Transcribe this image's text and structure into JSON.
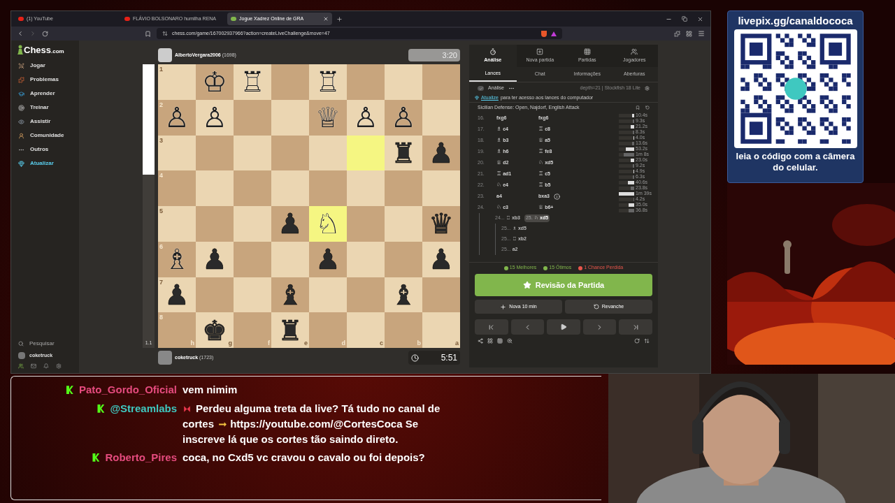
{
  "browser": {
    "tabs": [
      {
        "label": "(1) YouTube",
        "selected": false
      },
      {
        "label": "FLÁVIO BOLSONARO humilha RENA",
        "selected": false
      },
      {
        "label": "Jogue Xadrez Online de GRA",
        "selected": true
      }
    ],
    "url": "chess.com/game/167002937966?action=createLiveChallenge&move=47"
  },
  "sidebar": {
    "logo": "Chess",
    "logo_suffix": ".com",
    "items": [
      {
        "label": "Jogar",
        "kind": "link"
      },
      {
        "label": "Problemas",
        "kind": "link"
      },
      {
        "label": "Aprender",
        "kind": "link"
      },
      {
        "label": "Treinar",
        "kind": "link"
      },
      {
        "label": "Assistir",
        "kind": "link"
      },
      {
        "label": "Comunidade",
        "kind": "link"
      },
      {
        "label": "Outros",
        "kind": "more"
      },
      {
        "label": "Atualizar",
        "kind": "upgrade"
      }
    ],
    "search": "Pesquisar",
    "user": "coketruck"
  },
  "eval_bar": {
    "level": 0.39,
    "reading": "1.1"
  },
  "top_player": {
    "name": "AlbertoVergara2006",
    "rating": "(1698)",
    "clock": "3:20",
    "active": false
  },
  "bottom_player": {
    "name": "coketruck",
    "rating": "(1723)",
    "clock": "5:51",
    "active": true
  },
  "board": {
    "files": [
      "h",
      "g",
      "f",
      "e",
      "d",
      "c",
      "b",
      "a"
    ],
    "ranks": [
      {
        "label": "1",
        "squares": [
          {
            "highlighted": false
          },
          {
            "piece": "♔",
            "kind": "white",
            "highlighted": false
          },
          {
            "piece": "♖",
            "kind": "white",
            "highlighted": false
          },
          {
            "highlighted": false
          },
          {
            "piece": "♖",
            "kind": "white",
            "highlighted": false
          },
          {
            "highlighted": false
          },
          {
            "highlighted": false
          },
          {
            "highlighted": false
          }
        ]
      },
      {
        "label": "2",
        "squares": [
          {
            "piece": "♙",
            "kind": "white",
            "highlighted": false
          },
          {
            "piece": "♙",
            "kind": "white",
            "highlighted": false
          },
          {
            "highlighted": false
          },
          {
            "highlighted": false
          },
          {
            "piece": "♕",
            "kind": "white",
            "highlighted": false
          },
          {
            "piece": "♙",
            "kind": "white",
            "highlighted": false
          },
          {
            "piece": "♙",
            "kind": "white",
            "highlighted": false
          },
          {
            "highlighted": false
          }
        ]
      },
      {
        "label": "3",
        "squares": [
          {
            "highlighted": false
          },
          {
            "highlighted": false
          },
          {
            "highlighted": false
          },
          {
            "highlighted": false
          },
          {
            "highlighted": false
          },
          {
            "highlighted": true
          },
          {
            "piece": "♜",
            "kind": "black",
            "highlighted": false
          },
          {
            "piece": "♟",
            "kind": "black",
            "highlighted": false
          }
        ]
      },
      {
        "label": "4",
        "squares": [
          {
            "highlighted": false
          },
          {
            "highlighted": false
          },
          {
            "highlighted": false
          },
          {
            "highlighted": false
          },
          {
            "highlighted": false
          },
          {
            "highlighted": false
          },
          {
            "highlighted": false
          },
          {
            "highlighted": false
          }
        ]
      },
      {
        "label": "5",
        "squares": [
          {
            "highlighted": false
          },
          {
            "highlighted": false
          },
          {
            "highlighted": false
          },
          {
            "piece": "♟",
            "kind": "black",
            "highlighted": false
          },
          {
            "piece": "♘",
            "kind": "white",
            "highlighted": true
          },
          {
            "highlighted": false
          },
          {
            "highlighted": false
          },
          {
            "piece": "♛",
            "kind": "black",
            "highlighted": false
          }
        ]
      },
      {
        "label": "6",
        "squares": [
          {
            "piece": "♗",
            "kind": "white",
            "highlighted": false
          },
          {
            "piece": "♟",
            "kind": "black",
            "highlighted": false
          },
          {
            "highlighted": false
          },
          {
            "highlighted": false
          },
          {
            "piece": "♟",
            "kind": "black",
            "highlighted": false
          },
          {
            "highlighted": false
          },
          {
            "highlighted": false
          },
          {
            "piece": "♟",
            "kind": "black",
            "highlighted": false
          }
        ]
      },
      {
        "label": "7",
        "squares": [
          {
            "piece": "♟",
            "kind": "black",
            "highlighted": false
          },
          {
            "highlighted": false
          },
          {
            "highlighted": false
          },
          {
            "piece": "♝",
            "kind": "black",
            "highlighted": false
          },
          {
            "highlighted": false
          },
          {
            "highlighted": false
          },
          {
            "piece": "♝",
            "kind": "black",
            "highlighted": false
          },
          {
            "highlighted": false
          }
        ]
      },
      {
        "label": "8",
        "squares": [
          {
            "highlighted": false
          },
          {
            "piece": "♚",
            "kind": "black",
            "highlighted": false
          },
          {
            "highlighted": false
          },
          {
            "piece": "♜",
            "kind": "black",
            "highlighted": false
          },
          {
            "highlighted": false
          },
          {
            "highlighted": false
          },
          {
            "highlighted": false
          },
          {
            "highlighted": false
          }
        ]
      }
    ]
  },
  "panel": {
    "top_tabs": [
      {
        "label": "Análise",
        "selected": true
      },
      {
        "label": "Nova partida",
        "selected": false
      },
      {
        "label": "Partidas",
        "selected": false
      },
      {
        "label": "Jogadores",
        "selected": false
      }
    ],
    "sub_tabs": [
      {
        "label": "Lances",
        "selected": true
      },
      {
        "label": "Chat",
        "selected": false
      },
      {
        "label": "Informações",
        "selected": false
      },
      {
        "label": "Aberturas",
        "selected": false
      }
    ],
    "analysis": {
      "label": "Análise",
      "checked": true,
      "engine": "depth=21 | Stockfish 18 Lite"
    },
    "upgrade_link": "Atualize",
    "upgrade_text": "para ter acesso aos lances do computador",
    "opening": "Sicilian Defense: Open, Najdorf, English Attack",
    "moves": [
      {
        "number": "16.",
        "white": {
          "san": "fxg6"
        },
        "black": {
          "san": "fxg6"
        },
        "times": [
          {
            "reading": "10.4s",
            "level": 0.12
          },
          {
            "reading": "9.3s",
            "level": 0.1
          }
        ]
      },
      {
        "number": "17.",
        "white": {
          "figure": "♗",
          "san": "c4"
        },
        "black": {
          "figure": "♖",
          "san": "c8"
        },
        "times": [
          {
            "reading": "21.2s",
            "level": 0.22
          },
          {
            "reading": "8.3s",
            "level": 0.09
          }
        ]
      },
      {
        "number": "18.",
        "white": {
          "figure": "♗",
          "san": "b3"
        },
        "black": {
          "figure": "♕",
          "san": "a5"
        },
        "times": [
          {
            "reading": "4.0s",
            "level": 0.05
          },
          {
            "reading": "13.6s",
            "level": 0.15
          }
        ]
      },
      {
        "number": "19.",
        "white": {
          "figure": "♗",
          "san": "h6"
        },
        "black": {
          "figure": "♖",
          "san": "fe8"
        },
        "times": [
          {
            "reading": "53.2s",
            "level": 0.55
          },
          {
            "reading": "1m 8s",
            "level": 0.7
          }
        ]
      },
      {
        "number": "20.",
        "white": {
          "figure": "♕",
          "san": "d2"
        },
        "black": {
          "figure": "♘",
          "san": "xd5"
        },
        "times": [
          {
            "reading": "23.0s",
            "level": 0.24
          },
          {
            "reading": "9.2s",
            "level": 0.1
          }
        ]
      },
      {
        "number": "21.",
        "white": {
          "figure": "♖",
          "san": "ad1"
        },
        "black": {
          "figure": "♖",
          "san": "c5"
        },
        "times": [
          {
            "reading": "4.9s",
            "level": 0.05
          },
          {
            "reading": "6.3s",
            "level": 0.07
          }
        ]
      },
      {
        "number": "22.",
        "white": {
          "figure": "♘",
          "san": "e4"
        },
        "black": {
          "figure": "♖",
          "san": "b5"
        },
        "times": [
          {
            "reading": "40.6s",
            "level": 0.42
          },
          {
            "reading": "23.8s",
            "level": 0.25
          }
        ]
      },
      {
        "number": "23.",
        "white": {
          "san": "a4"
        },
        "black": {
          "san": "bxa3",
          "info": true
        },
        "times": [
          {
            "reading": "1m 39s",
            "level": 1
          },
          {
            "reading": "4.2s",
            "level": 0.05
          }
        ]
      },
      {
        "number": "24.",
        "white": {
          "figure": "♘",
          "san": "c3"
        },
        "black": {
          "figure": "♕",
          "san": "b6+"
        },
        "times": [
          {
            "reading": "35.0s",
            "level": 0.36
          },
          {
            "reading": "36.8s",
            "level": 0.38
          }
        ]
      }
    ],
    "variation": {
      "moves": [
        {
          "number": "24...",
          "figure": "♖",
          "san": "xb3",
          "selected": false
        },
        {
          "number": "25.",
          "figure": "♘",
          "san": "xd5",
          "selected": true
        }
      ],
      "children": [
        {
          "moves": [
            {
              "number": "25...",
              "figure": "♗",
              "san": "xd5",
              "selected": false
            }
          ]
        },
        {
          "moves": [
            {
              "number": "25...",
              "figure": "♖",
              "san": "xb2",
              "selected": false
            }
          ]
        },
        {
          "moves": [
            {
              "number": "25...",
              "san": "a2",
              "selected": false
            }
          ]
        }
      ]
    },
    "stats": [
      {
        "label": "15 Melhores",
        "color": "#81b64c"
      },
      {
        "label": "15 Ótimos",
        "color": "#81b64c"
      },
      {
        "label": "1 Chance Perdida",
        "color": "#e8564c"
      }
    ],
    "review_button": "Revisão da Partida",
    "new_game_button": "Nova 10 min",
    "rematch_button": "Revanche"
  },
  "chat": [
    {
      "user": "Pato_Gordo_Oficial",
      "color": "#e54b7e",
      "text": "vem nimim"
    },
    {
      "user": "@Streamlabs",
      "color": "#3fc8c0",
      "text": "Perdeu alguma treta da live? Tá tudo no canal de cortes",
      "link": "https://youtube.com/@CortesCoca",
      "after": "Se inscreve lá que os cortes tão saindo direto."
    },
    {
      "user": "Roberto_Pires",
      "color": "#e54b7e",
      "text": "coca, no Cxd5 vc cravou o cavalo ou foi depois?"
    }
  ],
  "qr_panel": {
    "title": "livepix.gg/canaldococa",
    "caption": "leia o código com a câmera do celular."
  }
}
